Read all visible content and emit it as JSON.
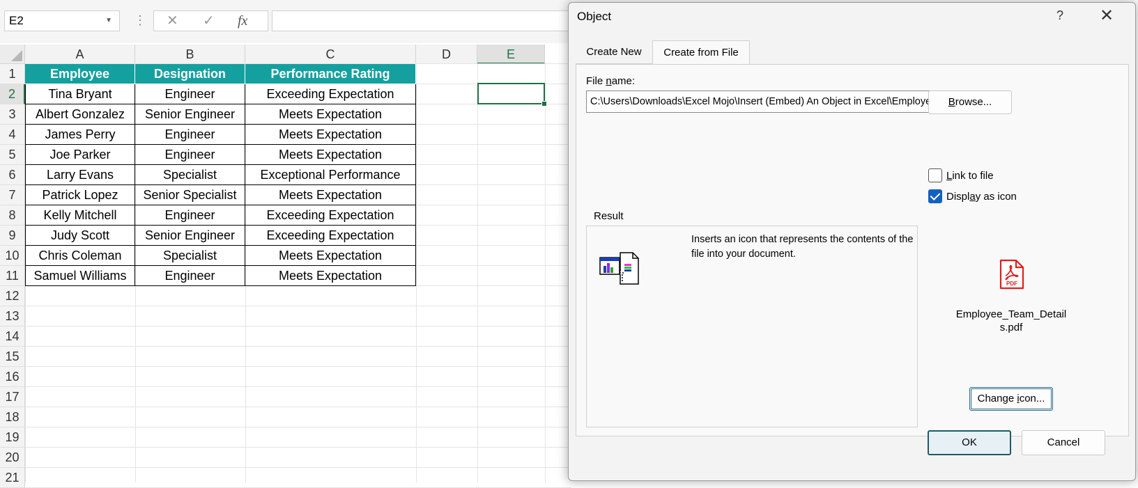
{
  "formula_bar": {
    "name_box": "E2",
    "cancel_glyph": "✕",
    "enter_glyph": "✓",
    "fx_label": "fx",
    "formula": ""
  },
  "grid": {
    "columns": [
      "A",
      "B",
      "C",
      "D",
      "E"
    ],
    "rows": [
      "1",
      "2",
      "3",
      "4",
      "5",
      "6",
      "7",
      "8",
      "9",
      "10",
      "11",
      "12",
      "13",
      "14",
      "15",
      "16",
      "17",
      "18",
      "19",
      "20",
      "21"
    ],
    "active_cell": "E2",
    "header_color": "#15a0a0",
    "selection_color": "#1e7145"
  },
  "table": {
    "headers": [
      "Employee",
      "Designation",
      "Performance Rating"
    ],
    "rows": [
      [
        "Tina Bryant",
        "Engineer",
        "Exceeding Expectation"
      ],
      [
        "Albert Gonzalez",
        "Senior Engineer",
        "Meets Expectation"
      ],
      [
        "James Perry",
        "Engineer",
        "Meets Expectation"
      ],
      [
        "Joe Parker",
        "Engineer",
        "Meets Expectation"
      ],
      [
        "Larry Evans",
        "Specialist",
        "Exceptional Performance"
      ],
      [
        "Patrick Lopez",
        "Senior Specialist",
        "Meets Expectation"
      ],
      [
        "Kelly Mitchell",
        "Engineer",
        "Exceeding Expectation"
      ],
      [
        "Judy Scott",
        "Senior Engineer",
        "Exceeding Expectation"
      ],
      [
        "Chris Coleman",
        "Specialist",
        "Meets Expectation"
      ],
      [
        "Samuel Williams",
        "Engineer",
        "Meets Expectation"
      ]
    ]
  },
  "dialog": {
    "title": "Object",
    "help": "?",
    "close": "✕",
    "tabs": [
      {
        "label": "Create New",
        "active": false
      },
      {
        "label": "Create from File",
        "active": true
      }
    ],
    "file_name_label_pre": "File ",
    "file_name_label_acc": "n",
    "file_name_label_post": "ame:",
    "file_name_value": "C:\\Users\\Downloads\\Excel Mojo\\Insert (Embed) An Object in Excel\\Employee_Team_Details.pdf",
    "browse_pre": "",
    "browse_acc": "B",
    "browse_post": "rowse...",
    "link_to_file_pre": "",
    "link_to_file_acc": "L",
    "link_to_file_post": "ink to file",
    "link_to_file_checked": false,
    "display_as_icon_pre": "Displ",
    "display_as_icon_acc": "a",
    "display_as_icon_post": "y as icon",
    "display_as_icon_checked": true,
    "result_label": "Result",
    "result_text": "Inserts an icon that represents the contents of the file into your document.",
    "pdf_icon_text": "PDF",
    "pdf_caption": "Employee_Team_Details.pdf",
    "change_icon_pre": "Change ",
    "change_icon_acc": "i",
    "change_icon_post": "con...",
    "ok": "OK",
    "cancel": "Cancel",
    "accent_color": "#1460c0",
    "pdf_color": "#e01e1e"
  }
}
